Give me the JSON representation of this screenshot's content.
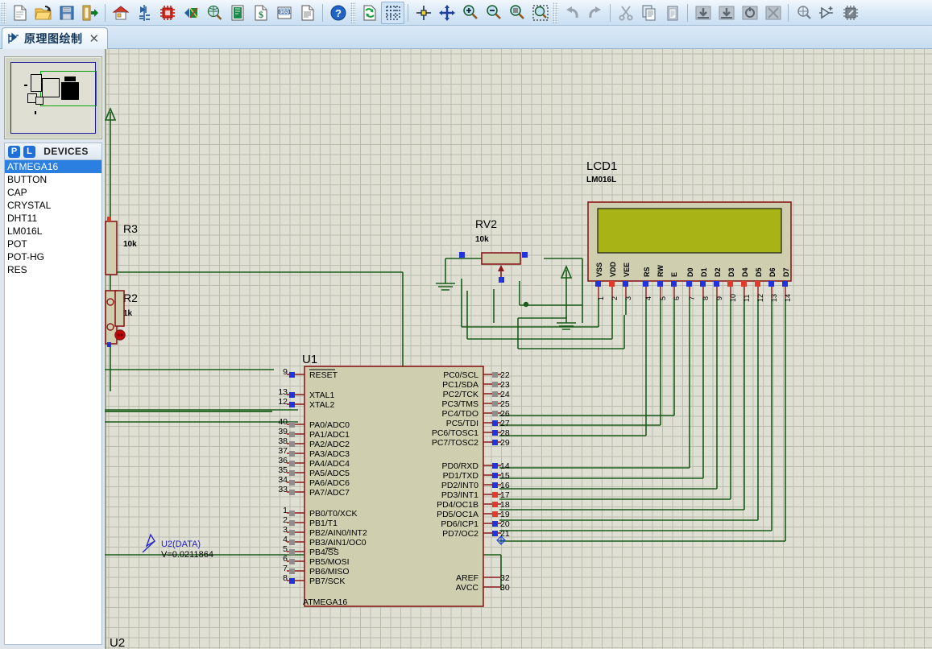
{
  "toolbar": {
    "groups": [
      {
        "name": "file",
        "buttons": [
          {
            "name": "new-sheet-button",
            "icon": "page-icon",
            "label": "New Sheet"
          },
          {
            "name": "open-button",
            "icon": "folder-open-icon",
            "label": "Open"
          },
          {
            "name": "save-button",
            "icon": "floppy-disk-icon",
            "label": "Save"
          },
          {
            "name": "import-export-button",
            "icon": "door-export-icon",
            "label": "Import/Export"
          }
        ]
      },
      {
        "name": "navigation",
        "buttons": [
          {
            "name": "home-button",
            "icon": "home-icon",
            "label": "Home Sheet"
          },
          {
            "name": "schematic-capture-button",
            "icon": "diode-icon",
            "label": "Schematic Capture"
          },
          {
            "name": "pcb-layout-button",
            "icon": "chip-icon",
            "label": "PCB Layout"
          },
          {
            "name": "3d-viewer-button",
            "icon": "3d-view-icon",
            "label": "3D Visualizer"
          },
          {
            "name": "design-explorer-button",
            "icon": "magnifier-globe-icon",
            "label": "Design Explorer"
          },
          {
            "name": "project-notes-button",
            "icon": "green-book-icon",
            "label": "Project Notes"
          },
          {
            "name": "bill-of-materials-button",
            "icon": "dollar-page-icon",
            "label": "Bill of Materials"
          },
          {
            "name": "netlist-button",
            "icon": "binary-page-icon",
            "label": "Netlist"
          },
          {
            "name": "report-button",
            "icon": "report-page-icon",
            "label": "Report"
          }
        ]
      },
      {
        "name": "help",
        "buttons": [
          {
            "name": "help-button",
            "icon": "question-help-icon",
            "label": "Help"
          }
        ]
      },
      {
        "name": "view",
        "buttons": [
          {
            "name": "refresh-button",
            "icon": "refresh-page-icon",
            "label": "Refresh"
          },
          {
            "name": "toggle-grid-button",
            "icon": "grid-icon",
            "label": "Toggle Grid",
            "selected": true
          },
          {
            "name": "origin-button",
            "icon": "origin-cross-icon",
            "label": "Set Origin"
          },
          {
            "name": "pan-button",
            "icon": "pan-arrows-icon",
            "label": "Pan"
          },
          {
            "name": "zoom-in-button",
            "icon": "zoom-in-icon",
            "label": "Zoom In"
          },
          {
            "name": "zoom-out-button",
            "icon": "zoom-out-icon",
            "label": "Zoom Out"
          },
          {
            "name": "zoom-all-button",
            "icon": "zoom-all-icon",
            "label": "Zoom to View Entire Sheet"
          },
          {
            "name": "zoom-area-button",
            "icon": "zoom-area-icon",
            "label": "Zoom to Area"
          }
        ]
      },
      {
        "name": "edit",
        "buttons": [
          {
            "name": "undo-button",
            "icon": "undo-arrow-icon",
            "label": "Undo"
          },
          {
            "name": "redo-button",
            "icon": "redo-arrow-icon",
            "label": "Redo"
          }
        ]
      },
      {
        "name": "clipboard",
        "buttons": [
          {
            "name": "cut-button",
            "icon": "scissors-icon",
            "label": "Cut"
          },
          {
            "name": "copy-button",
            "icon": "copy-pages-icon",
            "label": "Copy"
          },
          {
            "name": "paste-button",
            "icon": "clipboard-icon",
            "label": "Paste"
          }
        ]
      },
      {
        "name": "block",
        "buttons": [
          {
            "name": "block-copy-button",
            "icon": "block-copy-icon",
            "label": "Block Copy"
          },
          {
            "name": "block-move-button",
            "icon": "block-move-icon",
            "label": "Block Move"
          },
          {
            "name": "block-rotate-button",
            "icon": "block-rotate-icon",
            "label": "Block Rotate"
          },
          {
            "name": "block-delete-button",
            "icon": "block-delete-icon",
            "label": "Block Delete"
          }
        ]
      },
      {
        "name": "library",
        "buttons": [
          {
            "name": "pick-from-libraries-button",
            "icon": "pick-device-icon",
            "label": "Pick from Libraries"
          },
          {
            "name": "make-device-button",
            "icon": "make-device-icon",
            "label": "Make Device"
          },
          {
            "name": "packaging-tool-button",
            "icon": "packaging-tool-icon",
            "label": "Packaging Tool"
          }
        ]
      }
    ]
  },
  "tab": {
    "title": "原理图绘制",
    "close_label": "✕"
  },
  "sidebar": {
    "devices_header": {
      "p_badge": "P",
      "l_badge": "L",
      "title": "DEVICES"
    },
    "devices": [
      {
        "label": "ATMEGA16",
        "selected": true
      },
      {
        "label": "BUTTON",
        "selected": false
      },
      {
        "label": "CAP",
        "selected": false
      },
      {
        "label": "CRYSTAL",
        "selected": false
      },
      {
        "label": "DHT11",
        "selected": false
      },
      {
        "label": "LM016L",
        "selected": false
      },
      {
        "label": "POT",
        "selected": false
      },
      {
        "label": "POT-HG",
        "selected": false
      },
      {
        "label": "RES",
        "selected": false
      }
    ]
  },
  "schematic": {
    "colors": {
      "background": "#dfe0d3",
      "grid": "#b9bdac",
      "wire": "#1a5c1a",
      "component_outline": "#8b1a1a",
      "component_fill": "#cfcfb0",
      "lcd_screen": "#a8b416",
      "pin_blue": "#2233dd",
      "pin_red": "#e03a2a",
      "pin_gray": "#8d8d8d",
      "probe_text": "#2222cc"
    },
    "components": [
      {
        "name": "resistor-r3",
        "reference": "R3",
        "value": "10k"
      },
      {
        "name": "resistor-r2",
        "reference": "R2",
        "value": "1k"
      },
      {
        "name": "potentiometer-rv2",
        "reference": "RV2",
        "value": "10k"
      },
      {
        "name": "lcd-display",
        "reference": "LCD1",
        "value": "LM016L",
        "pin_names": [
          "VSS",
          "VDD",
          "VEE",
          "RS",
          "RW",
          "E",
          "D0",
          "D1",
          "D2",
          "D3",
          "D4",
          "D5",
          "D6",
          "D7"
        ],
        "pin_numbers": [
          "1",
          "2",
          "3",
          "4",
          "5",
          "6",
          "7",
          "8",
          "9",
          "10",
          "11",
          "12",
          "13",
          "14"
        ],
        "pin_colors": [
          "blue",
          "red",
          "blue",
          "blue",
          "blue",
          "blue",
          "blue",
          "blue",
          "blue",
          "red",
          "red",
          "red",
          "blue",
          "blue"
        ]
      },
      {
        "name": "microcontroller-u1",
        "reference": "U1",
        "value": "ATMEGA16",
        "left_pins": [
          {
            "label": "RESET",
            "number": "9",
            "overline": true,
            "color": "blue"
          },
          {
            "label": "XTAL1",
            "number": "13",
            "overline": false,
            "color": "blue"
          },
          {
            "label": "XTAL2",
            "number": "12",
            "overline": false,
            "color": "blue"
          },
          {
            "label": "PA0/ADC0",
            "number": "40",
            "overline": false,
            "color": "gray"
          },
          {
            "label": "PA1/ADC1",
            "number": "39",
            "overline": false,
            "color": "gray"
          },
          {
            "label": "PA2/ADC2",
            "number": "38",
            "overline": false,
            "color": "gray"
          },
          {
            "label": "PA3/ADC3",
            "number": "37",
            "overline": false,
            "color": "gray"
          },
          {
            "label": "PA4/ADC4",
            "number": "36",
            "overline": false,
            "color": "gray"
          },
          {
            "label": "PA5/ADC5",
            "number": "35",
            "overline": false,
            "color": "gray"
          },
          {
            "label": "PA6/ADC6",
            "number": "34",
            "overline": false,
            "color": "gray"
          },
          {
            "label": "PA7/ADC7",
            "number": "33",
            "overline": false,
            "color": "gray"
          },
          {
            "label": "PB0/T0/XCK",
            "number": "1",
            "overline": false,
            "color": "gray"
          },
          {
            "label": "PB1/T1",
            "number": "2",
            "overline": false,
            "color": "gray"
          },
          {
            "label": "PB2/AIN0/INT2",
            "number": "3",
            "overline": false,
            "color": "gray"
          },
          {
            "label": "PB3/AIN1/OC0",
            "number": "4",
            "overline": false,
            "color": "gray"
          },
          {
            "label": "PB4/SS",
            "number": "5",
            "overline": false,
            "color": "gray"
          },
          {
            "label": "PB5/MOSI",
            "number": "6",
            "overline": false,
            "color": "gray"
          },
          {
            "label": "PB6/MISO",
            "number": "7",
            "overline": false,
            "color": "gray"
          },
          {
            "label": "PB7/SCK",
            "number": "8",
            "overline": false,
            "color": "blue"
          }
        ],
        "right_pins": [
          {
            "label": "PC0/SCL",
            "number": "22",
            "color": "gray"
          },
          {
            "label": "PC1/SDA",
            "number": "23",
            "color": "gray"
          },
          {
            "label": "PC2/TCK",
            "number": "24",
            "color": "gray"
          },
          {
            "label": "PC3/TMS",
            "number": "25",
            "color": "gray"
          },
          {
            "label": "PC4/TDO",
            "number": "26",
            "color": "gray"
          },
          {
            "label": "PC5/TDI",
            "number": "27",
            "color": "blue"
          },
          {
            "label": "PC6/TOSC1",
            "number": "28",
            "color": "blue"
          },
          {
            "label": "PC7/TOSC2",
            "number": "29",
            "color": "blue"
          },
          {
            "label": "PD0/RXD",
            "number": "14",
            "color": "blue"
          },
          {
            "label": "PD1/TXD",
            "number": "15",
            "color": "blue"
          },
          {
            "label": "PD2/INT0",
            "number": "16",
            "color": "blue"
          },
          {
            "label": "PD3/INT1",
            "number": "17",
            "color": "red"
          },
          {
            "label": "PD4/OC1B",
            "number": "18",
            "color": "red"
          },
          {
            "label": "PD5/OC1A",
            "number": "19",
            "color": "red"
          },
          {
            "label": "PD6/ICP1",
            "number": "20",
            "color": "blue"
          },
          {
            "label": "PD7/OC2",
            "number": "21",
            "color": "blue"
          },
          {
            "label": "AREF",
            "number": "32",
            "color": "none"
          },
          {
            "label": "AVCC",
            "number": "30",
            "color": "none"
          }
        ]
      },
      {
        "name": "sensor-u2",
        "reference": "U2"
      }
    ],
    "probe": {
      "name": "voltage-probe-u2-data",
      "label": "U2(DATA)",
      "value_text": "V=0.0211864"
    }
  }
}
